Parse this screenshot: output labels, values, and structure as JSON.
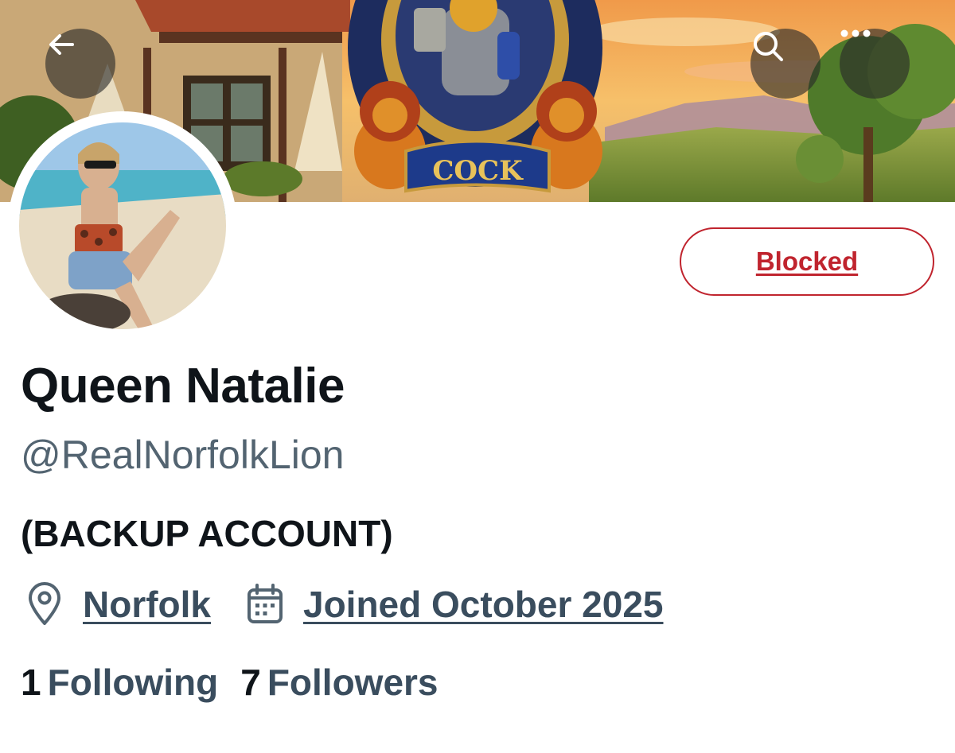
{
  "header": {
    "banner_sign_text": "COCK",
    "back_icon": "arrow-left-icon",
    "search_icon": "search-icon",
    "more_icon": "more-horizontal-icon"
  },
  "profile": {
    "display_name": "Queen Natalie",
    "handle": "@RealNorfolkLion",
    "bio": "(BACKUP ACCOUNT)",
    "location": "Norfolk",
    "location_icon": "location-pin-icon",
    "joined": "Joined October 2025",
    "joined_icon": "calendar-icon",
    "following_count": "1",
    "following_label": "Following",
    "followers_count": "7",
    "followers_label": "Followers"
  },
  "actions": {
    "blocked_label": "Blocked"
  },
  "colors": {
    "blocked_red": "#c0242e",
    "text_primary": "#0f1419",
    "text_secondary": "#536471",
    "link_dark": "#3a4d5e"
  }
}
